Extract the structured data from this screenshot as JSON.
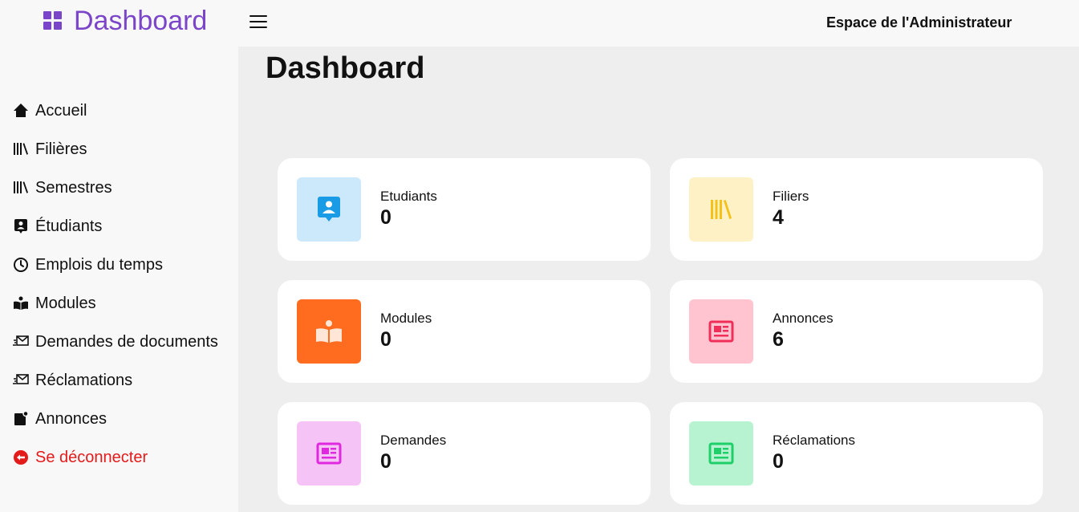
{
  "header": {
    "brand_title": "Dashboard",
    "admin_label": "Espace de l'Administrateur"
  },
  "sidebar": {
    "items": [
      {
        "label": "Accueil",
        "icon": "home-icon"
      },
      {
        "label": "Filières",
        "icon": "library-icon"
      },
      {
        "label": "Semestres",
        "icon": "library-icon"
      },
      {
        "label": "Étudiants",
        "icon": "student-card-icon"
      },
      {
        "label": "Emplois du temps",
        "icon": "clock-icon"
      },
      {
        "label": "Modules",
        "icon": "open-book-icon"
      },
      {
        "label": "Demandes de documents",
        "icon": "mail-send-icon"
      },
      {
        "label": "Réclamations",
        "icon": "mail-send-icon"
      },
      {
        "label": "Annonces",
        "icon": "announcement-icon"
      },
      {
        "label": "Se déconnecter",
        "icon": "logout-icon"
      }
    ]
  },
  "main": {
    "title": "Dashboard",
    "cards": [
      {
        "label": "Etudiants",
        "value": "0",
        "icon": "student-card-icon",
        "bg": "#cce9fb",
        "fg": "#1a9be6"
      },
      {
        "label": "Filiers",
        "value": "4",
        "icon": "library-icon",
        "bg": "#fff1c6",
        "fg": "#f5c116"
      },
      {
        "label": "Modules",
        "value": "0",
        "icon": "open-book-icon",
        "bg": "#ff6b1f",
        "fg": "#ffe6d6"
      },
      {
        "label": "Annonces",
        "value": "6",
        "icon": "newspaper-icon",
        "bg": "#ffc4d0",
        "fg": "#ef2f5a"
      },
      {
        "label": "Demandes",
        "value": "0",
        "icon": "newspaper-icon",
        "bg": "#f6c3f6",
        "fg": "#df29df"
      },
      {
        "label": "Réclamations",
        "value": "0",
        "icon": "newspaper-icon",
        "bg": "#b7f3d1",
        "fg": "#1fcf6a"
      }
    ]
  },
  "colors": {
    "brand": "#7b45c9",
    "logout": "#e41b1b"
  }
}
